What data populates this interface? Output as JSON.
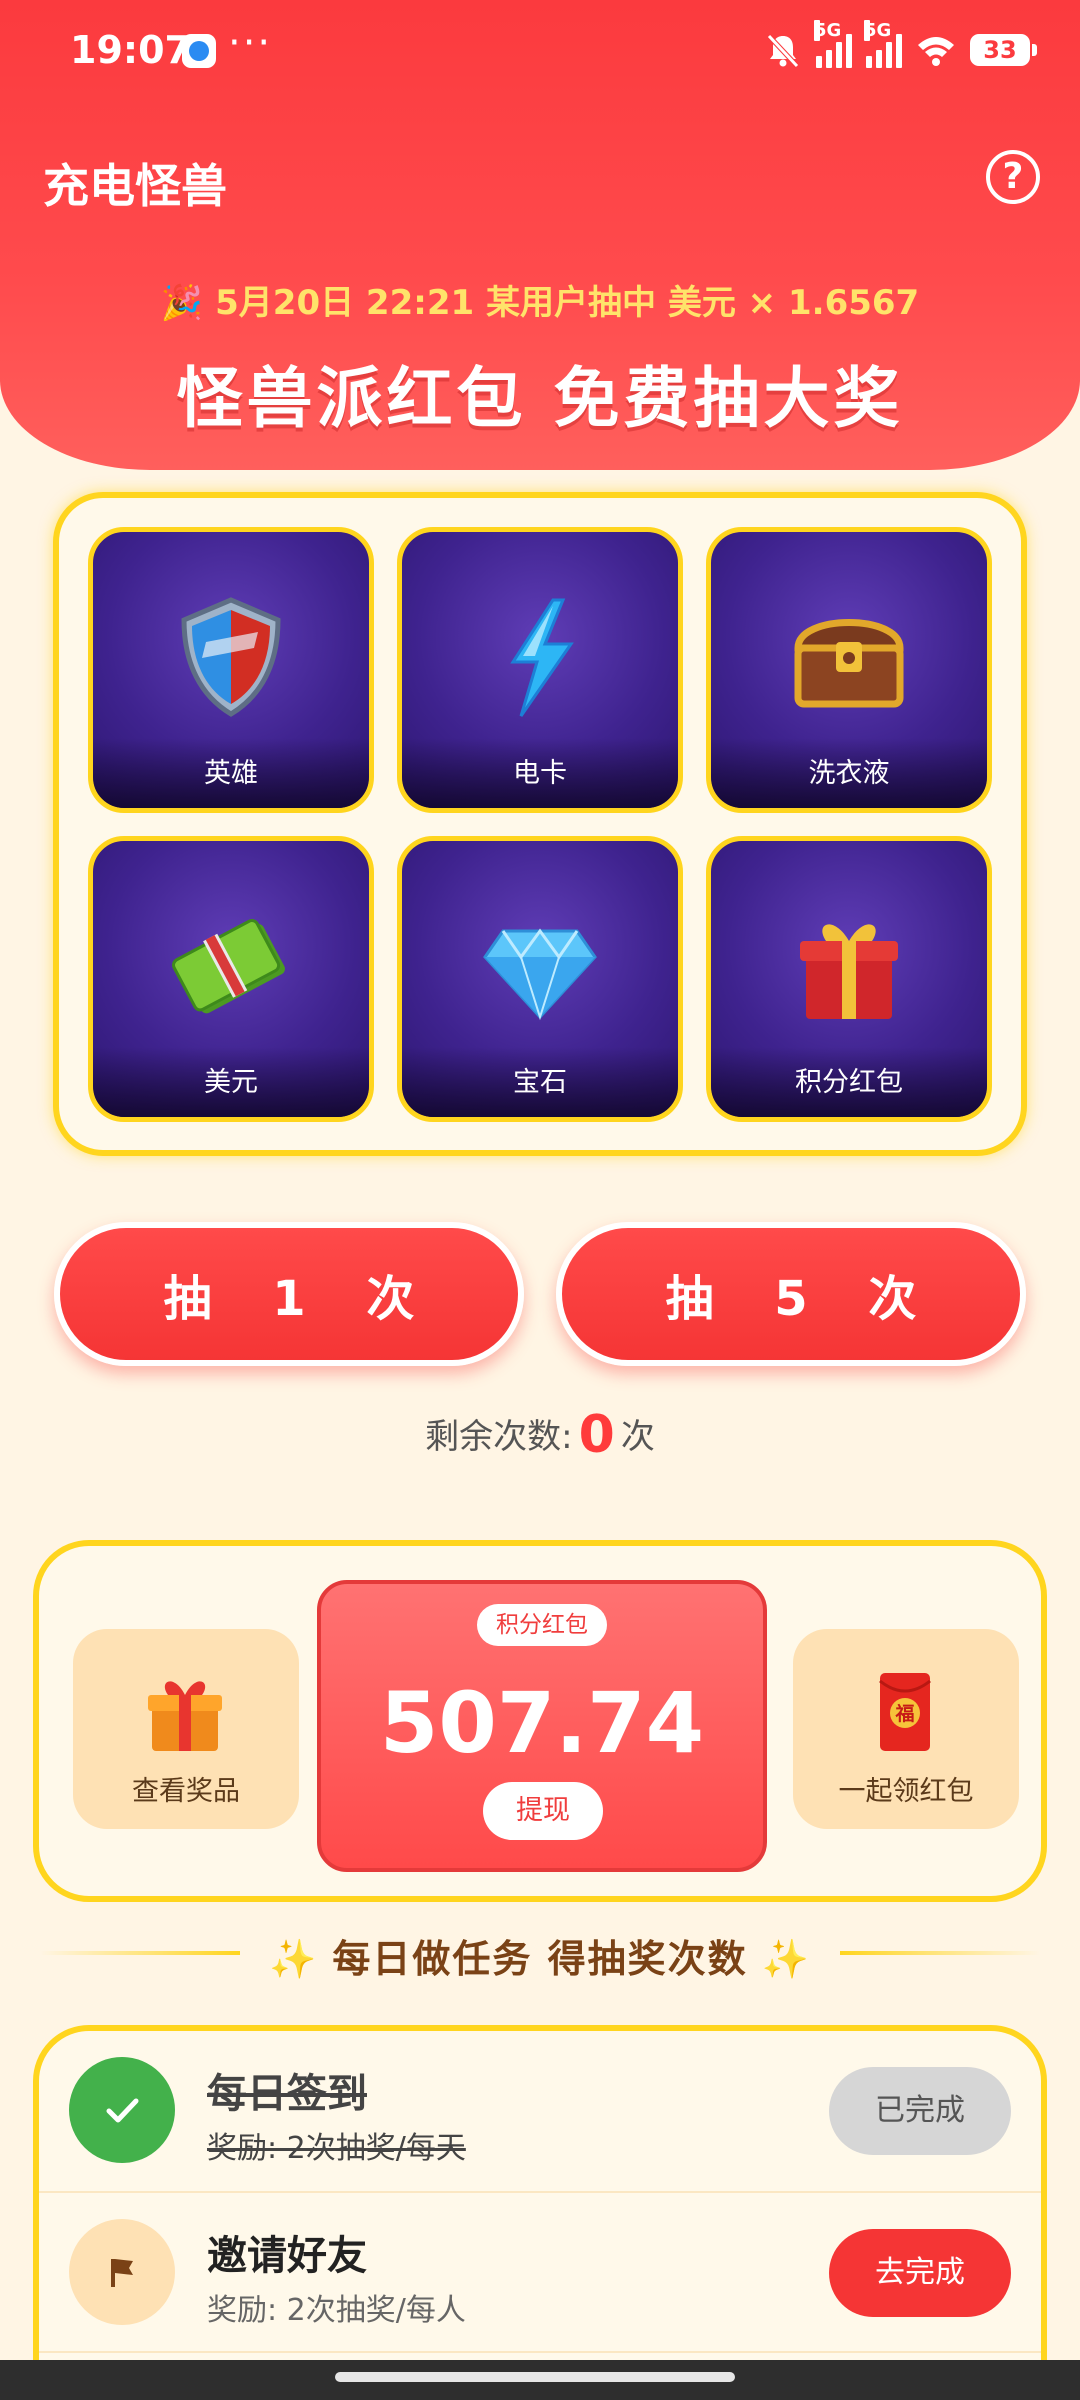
{
  "status_bar": {
    "time": "19:07",
    "dots": "···",
    "network_1": "5G",
    "network_2": "5G",
    "battery": "33"
  },
  "header": {
    "app_title": "充电怪兽",
    "help_icon": "?",
    "marquee": "5月20日 22:21 某用户抽中 美元 × 1.6567",
    "banner_title": "怪兽派红包 免费抽大奖"
  },
  "prizes": [
    {
      "label": "英雄",
      "icon": "shield-icon"
    },
    {
      "label": "电卡",
      "icon": "lightning-icon"
    },
    {
      "label": "洗衣液",
      "icon": "treasure-chest-icon"
    },
    {
      "label": "美元",
      "icon": "cash-icon"
    },
    {
      "label": "宝石",
      "icon": "diamond-icon"
    },
    {
      "label": "积分红包",
      "icon": "gift-box-icon"
    }
  ],
  "draw": {
    "draw_once": "抽 1 次",
    "draw_five": "抽 5 次",
    "remaining_prefix": "剩余次数:",
    "remaining_count": "0",
    "remaining_unit": "次"
  },
  "points": {
    "left_tile": "查看奖品",
    "tag": "积分红包",
    "value": "507.74",
    "withdraw": "提现",
    "right_tile": "一起领红包",
    "right_tile_glyph": "福"
  },
  "tasks_section": {
    "title": "每日做任务 得抽奖次数",
    "sparkle": "✨"
  },
  "tasks": [
    {
      "title": "每日签到",
      "reward": "奖励: 2次抽奖/每天",
      "button": "已完成",
      "status": "done"
    },
    {
      "title": "邀请好友",
      "reward": "奖励: 2次抽奖/每人",
      "button": "去完成",
      "status": "todo"
    }
  ],
  "colors": {
    "primary_red": "#FB3A3E",
    "gold_border": "#FFD51E",
    "page_bg": "#FFF5E4",
    "marquee_yellow": "#FFE36A",
    "done_green": "#43B14B"
  }
}
